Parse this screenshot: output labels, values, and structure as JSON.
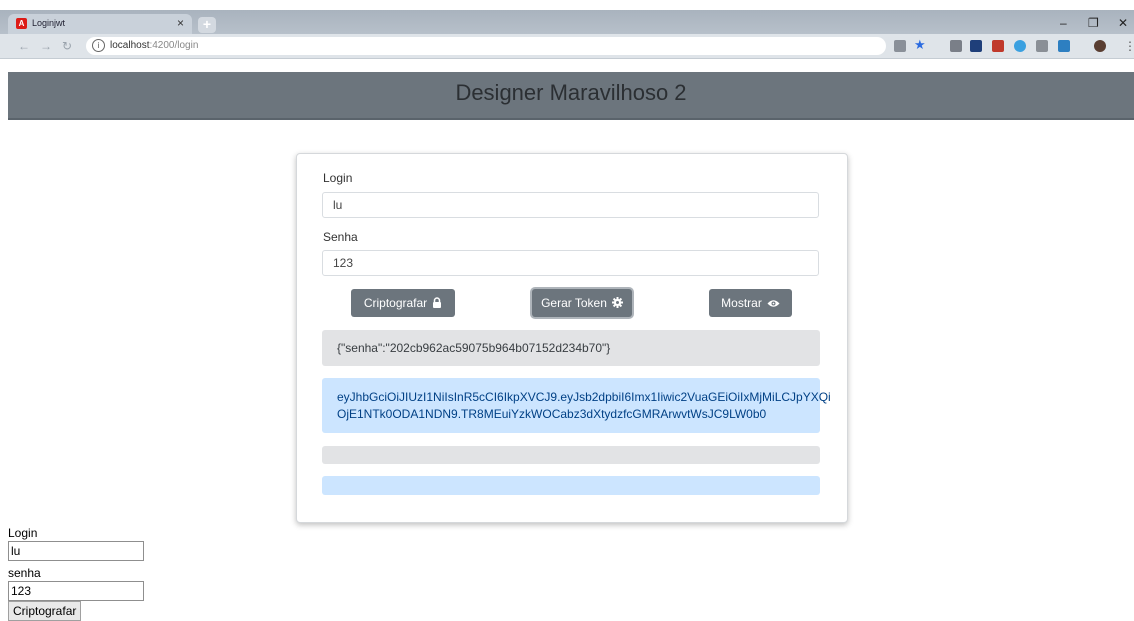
{
  "browser": {
    "tab_title": "Loginjwt",
    "tab_close": "×",
    "new_tab": "+",
    "url_host": "localhost",
    "url_path": ":4200/login"
  },
  "app": {
    "title": "Designer Maravilhoso 2"
  },
  "form": {
    "login_label": "Login",
    "login_value": "lu",
    "senha_label": "Senha",
    "senha_value": "123",
    "buttons": {
      "encrypt": "Criptografar",
      "token": "Gerar Token",
      "show": "Mostrar"
    },
    "hash_output": "{\"senha\":\"202cb962ac59075b964b07152d234b70\"}",
    "token_output_line1": "eyJhbGciOiJIUzI1NiIsInR5cCI6IkpXVCJ9.eyJsb2dpbiI6Imx1Iiwic2VuaGEiOiIxMjMiLCJpYXQi",
    "token_output_line2": "OjE1NTk0ODA1NDN9.TR8MEuiYzkWOCabz3dXtydzfcGMRArwvtWsJC9LW0b0",
    "empty_grey": "",
    "empty_blue": ""
  },
  "raw_form": {
    "login_label": "Login",
    "login_value": "lu",
    "senha_label": "senha",
    "senha_value": "123",
    "button": "Criptografar"
  },
  "colors": {
    "header_bg": "#6c757d",
    "button_bg": "#6c757d",
    "alert_grey": "#e2e3e5",
    "alert_blue": "#cce5ff",
    "token_text": "#004085"
  }
}
